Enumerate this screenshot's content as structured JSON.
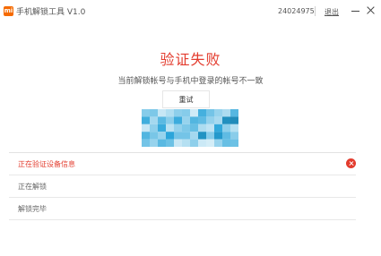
{
  "window": {
    "title": "手机解锁工具 V1.0",
    "logo_text": "mi",
    "account_id": "24024975",
    "logout_label": "退出"
  },
  "result": {
    "title": "验证失败",
    "description": "当前解锁帐号与手机中登录的帐号不一致",
    "retry_label": "重试"
  },
  "steps": [
    {
      "label": "正在验证设备信息",
      "status": "error"
    },
    {
      "label": "正在解锁",
      "status": "pending"
    },
    {
      "label": "解锁完毕",
      "status": "pending"
    }
  ],
  "colors": {
    "accent": "#e33c2e",
    "brand": "#f56a00",
    "qr": "#3aa9d9"
  }
}
